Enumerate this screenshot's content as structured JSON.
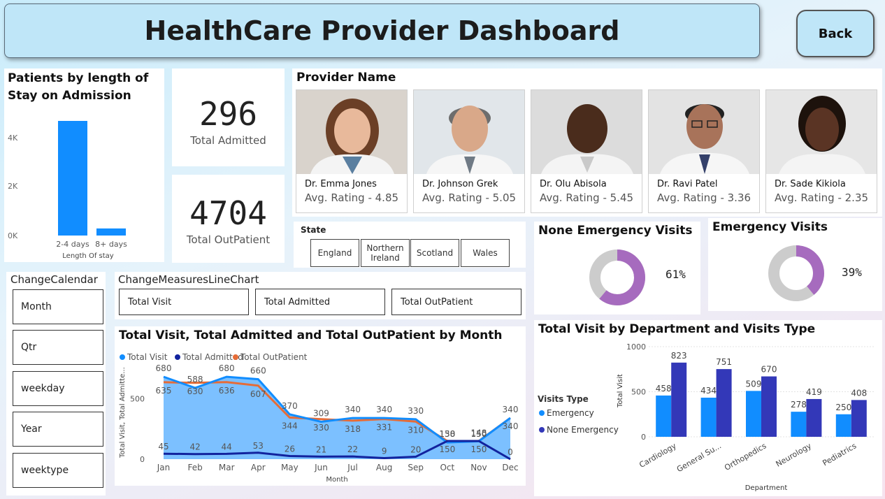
{
  "header": {
    "title": "HealthCare Provider Dashboard",
    "back_label": "Back"
  },
  "los": {
    "title_line1": "Patients by length of",
    "title_line2": "Stay on Admission",
    "xlabel": "Length Of stay",
    "yticks": [
      "0K",
      "2K",
      "4K"
    ]
  },
  "kpi": {
    "admitted_value": "296",
    "admitted_label": "Total Admitted",
    "outpatient_value": "4704",
    "outpatient_label": "Total OutPatient"
  },
  "providers": {
    "title": "Provider Name",
    "items": [
      {
        "name": "Dr. Emma Jones",
        "rating": "Avg. Rating - 4.85"
      },
      {
        "name": "Dr. Johnson Grek",
        "rating": "Avg. Rating - 5.05"
      },
      {
        "name": "Dr. Olu Abisola",
        "rating": "Avg. Rating - 5.45"
      },
      {
        "name": "Dr. Ravi Patel",
        "rating": "Avg. Rating - 3.36"
      },
      {
        "name": "Dr. Sade Kikiola",
        "rating": "Avg. Rating - 2.35"
      }
    ]
  },
  "state": {
    "title": "State",
    "options": [
      "England",
      "Northern Ireland",
      "Scotland",
      "Wales"
    ]
  },
  "none_emergency": {
    "title": "None Emergency Visits",
    "pct_label": "61%"
  },
  "emergency": {
    "title": "Emergency Visits",
    "pct_label": "39%"
  },
  "calendar": {
    "title": "ChangeCalendar",
    "options": [
      "Month",
      "Qtr",
      "weekday",
      "Year",
      "weektype"
    ]
  },
  "measures": {
    "title": "ChangeMeasuresLineChart",
    "options": [
      "Total Visit",
      "Total Admitted",
      "Total OutPatient"
    ]
  },
  "colors": {
    "total_visit": "#118dff",
    "total_admitted": "#12239e",
    "total_outpatient": "#e66c37",
    "donut_fill": "#a66bbe",
    "donut_rest": "#cccccc",
    "emergency": "#118dff",
    "none_emergency": "#3338b8"
  },
  "chart_data": [
    {
      "type": "bar",
      "categories": [
        "2-4 days",
        "8+ days"
      ],
      "values": [
        4700,
        290
      ],
      "xlabel": "Length Of stay",
      "ylim": [
        0,
        4700
      ]
    },
    {
      "type": "pie",
      "title": "None Emergency Visits",
      "values": [
        61,
        39
      ]
    },
    {
      "type": "pie",
      "title": "Emergency Visits",
      "values": [
        39,
        61
      ]
    },
    {
      "type": "area",
      "title": "Total Visit, Total Admitted and Total OutPatient by Month",
      "xlabel": "Month",
      "ylabel": "Total Visit, Total Admitte...",
      "x": [
        "Jan",
        "Feb",
        "Mar",
        "Apr",
        "May",
        "Jun",
        "Jul",
        "Aug",
        "Sep",
        "Oct",
        "Nov",
        "Dec"
      ],
      "yticks": [
        0,
        500
      ],
      "ylim": [
        0,
        750
      ],
      "series": [
        {
          "name": "Total Visit",
          "values": [
            680,
            588,
            680,
            660,
            370,
            309,
            340,
            340,
            330,
            138,
            148,
            340
          ]
        },
        {
          "name": "Total Admitted",
          "values": [
            45,
            42,
            44,
            53,
            26,
            21,
            22,
            9,
            20,
            150,
            150,
            0
          ]
        },
        {
          "name": "Total OutPatient",
          "values": [
            635,
            630,
            636,
            607,
            344,
            330,
            318,
            331,
            310,
            150,
            150,
            340
          ]
        }
      ],
      "legend": "top"
    },
    {
      "type": "bar",
      "title": "Total Visit by Department and Visits Type",
      "xlabel": "Department",
      "ylabel": "Total Visit",
      "categories": [
        "Cardiology",
        "General Su...",
        "Orthopedics",
        "Neurology",
        "Pediatrics"
      ],
      "yticks": [
        0,
        500,
        1000
      ],
      "ylim": [
        0,
        1000
      ],
      "legend_title": "Visits Type",
      "series": [
        {
          "name": "Emergency",
          "values": [
            458,
            434,
            509,
            278,
            250
          ]
        },
        {
          "name": "None Emergency",
          "values": [
            823,
            751,
            670,
            419,
            408
          ]
        }
      ]
    }
  ]
}
